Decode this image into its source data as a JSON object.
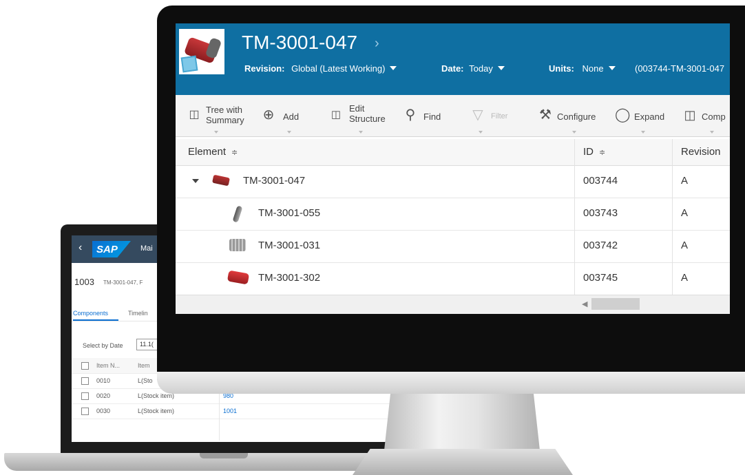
{
  "laptop": {
    "app_title": "Mai",
    "back_icon": "chevron-left-icon",
    "logo_text": "SAP",
    "object_title": "1003",
    "object_subtitle": "TM-3001-047, F",
    "tabs": [
      "Components",
      "Timelin"
    ],
    "active_tab": "Components",
    "filter_label": "Select by Date",
    "filter_value": "11.1(",
    "table_headers": [
      "Item N...",
      "Item"
    ],
    "rows": [
      {
        "item_no": "0010",
        "item_cat": "L(Sto",
        "component": ""
      },
      {
        "item_no": "0020",
        "item_cat": "L(Stock item)",
        "component": "980"
      },
      {
        "item_no": "0030",
        "item_cat": "L(Stock item)",
        "component": "1001"
      }
    ]
  },
  "monitor": {
    "header": {
      "title": "TM-3001-047",
      "title_chevron": "›",
      "revision_label": "Revision:",
      "revision_value": "Global (Latest Working)",
      "date_label": "Date:",
      "date_value": "Today",
      "units_label": "Units:",
      "units_value": "None",
      "context_text": "(003744-TM-3001-047"
    },
    "toolbar": {
      "tree_summary_line1": "Tree with",
      "tree_summary_line2": "Summary",
      "add": "Add",
      "edit_structure_line1": "Edit",
      "edit_structure_line2": "Structure",
      "find": "Find",
      "filter": "Filter",
      "configure": "Configure",
      "expand": "Expand",
      "compare": "Comp"
    },
    "grid": {
      "columns": [
        "Element",
        "ID",
        "Revision"
      ],
      "sort_glyph": "≑",
      "rows": [
        {
          "element": "TM-3001-047",
          "id": "003744",
          "revision": "A",
          "expanded": true,
          "icon": "motor-assembly-icon"
        },
        {
          "element": "TM-3001-055",
          "id": "003743",
          "revision": "A",
          "icon": "shaft-part-icon"
        },
        {
          "element": "TM-3001-031",
          "id": "003742",
          "revision": "A",
          "icon": "housing-part-icon"
        },
        {
          "element": "TM-3001-302",
          "id": "003745",
          "revision": "A",
          "icon": "motor-part-icon"
        }
      ]
    },
    "colors": {
      "header_bg": "#0f6fa2",
      "sap_shell": "#354a5f",
      "link": "#0a6ed1"
    }
  }
}
